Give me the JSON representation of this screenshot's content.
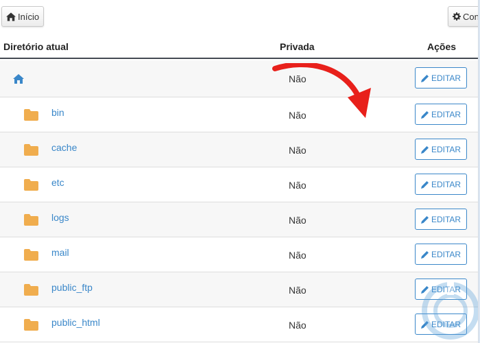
{
  "toolbar": {
    "home_label": "Início",
    "config_label": "Con"
  },
  "table": {
    "headers": {
      "directory": "Diretório atual",
      "private": "Privada",
      "actions": "Ações"
    },
    "rows": [
      {
        "name": "",
        "icon": "home-icon",
        "private": "Não",
        "action": "EDITAR"
      },
      {
        "name": "bin",
        "icon": "folder-icon",
        "private": "Não",
        "action": "EDITAR"
      },
      {
        "name": "cache",
        "icon": "folder-icon",
        "private": "Não",
        "action": "EDITAR"
      },
      {
        "name": "etc",
        "icon": "folder-icon",
        "private": "Não",
        "action": "EDITAR"
      },
      {
        "name": "logs",
        "icon": "folder-icon",
        "private": "Não",
        "action": "EDITAR"
      },
      {
        "name": "mail",
        "icon": "folder-icon",
        "private": "Não",
        "action": "EDITAR"
      },
      {
        "name": "public_ftp",
        "icon": "folder-icon",
        "private": "Não",
        "action": "EDITAR"
      },
      {
        "name": "public_html",
        "icon": "folder-icon",
        "private": "Não",
        "action": "EDITAR"
      }
    ]
  },
  "colors": {
    "accent": "#3a87c9",
    "folder": "#f0ad4e",
    "annotation_arrow": "#e8201b"
  }
}
